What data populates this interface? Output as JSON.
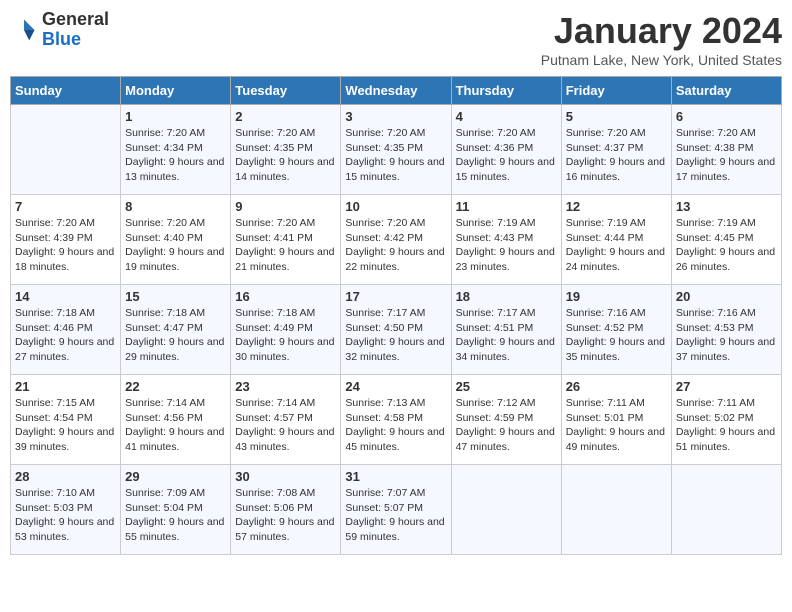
{
  "header": {
    "logo": {
      "general": "General",
      "blue": "Blue"
    },
    "title": "January 2024",
    "location": "Putnam Lake, New York, United States"
  },
  "weekdays": [
    "Sunday",
    "Monday",
    "Tuesday",
    "Wednesday",
    "Thursday",
    "Friday",
    "Saturday"
  ],
  "weeks": [
    [
      {
        "day": "",
        "sunrise": "",
        "sunset": "",
        "daylight": ""
      },
      {
        "day": "1",
        "sunrise": "Sunrise: 7:20 AM",
        "sunset": "Sunset: 4:34 PM",
        "daylight": "Daylight: 9 hours and 13 minutes."
      },
      {
        "day": "2",
        "sunrise": "Sunrise: 7:20 AM",
        "sunset": "Sunset: 4:35 PM",
        "daylight": "Daylight: 9 hours and 14 minutes."
      },
      {
        "day": "3",
        "sunrise": "Sunrise: 7:20 AM",
        "sunset": "Sunset: 4:35 PM",
        "daylight": "Daylight: 9 hours and 15 minutes."
      },
      {
        "day": "4",
        "sunrise": "Sunrise: 7:20 AM",
        "sunset": "Sunset: 4:36 PM",
        "daylight": "Daylight: 9 hours and 15 minutes."
      },
      {
        "day": "5",
        "sunrise": "Sunrise: 7:20 AM",
        "sunset": "Sunset: 4:37 PM",
        "daylight": "Daylight: 9 hours and 16 minutes."
      },
      {
        "day": "6",
        "sunrise": "Sunrise: 7:20 AM",
        "sunset": "Sunset: 4:38 PM",
        "daylight": "Daylight: 9 hours and 17 minutes."
      }
    ],
    [
      {
        "day": "7",
        "sunrise": "Sunrise: 7:20 AM",
        "sunset": "Sunset: 4:39 PM",
        "daylight": "Daylight: 9 hours and 18 minutes."
      },
      {
        "day": "8",
        "sunrise": "Sunrise: 7:20 AM",
        "sunset": "Sunset: 4:40 PM",
        "daylight": "Daylight: 9 hours and 19 minutes."
      },
      {
        "day": "9",
        "sunrise": "Sunrise: 7:20 AM",
        "sunset": "Sunset: 4:41 PM",
        "daylight": "Daylight: 9 hours and 21 minutes."
      },
      {
        "day": "10",
        "sunrise": "Sunrise: 7:20 AM",
        "sunset": "Sunset: 4:42 PM",
        "daylight": "Daylight: 9 hours and 22 minutes."
      },
      {
        "day": "11",
        "sunrise": "Sunrise: 7:19 AM",
        "sunset": "Sunset: 4:43 PM",
        "daylight": "Daylight: 9 hours and 23 minutes."
      },
      {
        "day": "12",
        "sunrise": "Sunrise: 7:19 AM",
        "sunset": "Sunset: 4:44 PM",
        "daylight": "Daylight: 9 hours and 24 minutes."
      },
      {
        "day": "13",
        "sunrise": "Sunrise: 7:19 AM",
        "sunset": "Sunset: 4:45 PM",
        "daylight": "Daylight: 9 hours and 26 minutes."
      }
    ],
    [
      {
        "day": "14",
        "sunrise": "Sunrise: 7:18 AM",
        "sunset": "Sunset: 4:46 PM",
        "daylight": "Daylight: 9 hours and 27 minutes."
      },
      {
        "day": "15",
        "sunrise": "Sunrise: 7:18 AM",
        "sunset": "Sunset: 4:47 PM",
        "daylight": "Daylight: 9 hours and 29 minutes."
      },
      {
        "day": "16",
        "sunrise": "Sunrise: 7:18 AM",
        "sunset": "Sunset: 4:49 PM",
        "daylight": "Daylight: 9 hours and 30 minutes."
      },
      {
        "day": "17",
        "sunrise": "Sunrise: 7:17 AM",
        "sunset": "Sunset: 4:50 PM",
        "daylight": "Daylight: 9 hours and 32 minutes."
      },
      {
        "day": "18",
        "sunrise": "Sunrise: 7:17 AM",
        "sunset": "Sunset: 4:51 PM",
        "daylight": "Daylight: 9 hours and 34 minutes."
      },
      {
        "day": "19",
        "sunrise": "Sunrise: 7:16 AM",
        "sunset": "Sunset: 4:52 PM",
        "daylight": "Daylight: 9 hours and 35 minutes."
      },
      {
        "day": "20",
        "sunrise": "Sunrise: 7:16 AM",
        "sunset": "Sunset: 4:53 PM",
        "daylight": "Daylight: 9 hours and 37 minutes."
      }
    ],
    [
      {
        "day": "21",
        "sunrise": "Sunrise: 7:15 AM",
        "sunset": "Sunset: 4:54 PM",
        "daylight": "Daylight: 9 hours and 39 minutes."
      },
      {
        "day": "22",
        "sunrise": "Sunrise: 7:14 AM",
        "sunset": "Sunset: 4:56 PM",
        "daylight": "Daylight: 9 hours and 41 minutes."
      },
      {
        "day": "23",
        "sunrise": "Sunrise: 7:14 AM",
        "sunset": "Sunset: 4:57 PM",
        "daylight": "Daylight: 9 hours and 43 minutes."
      },
      {
        "day": "24",
        "sunrise": "Sunrise: 7:13 AM",
        "sunset": "Sunset: 4:58 PM",
        "daylight": "Daylight: 9 hours and 45 minutes."
      },
      {
        "day": "25",
        "sunrise": "Sunrise: 7:12 AM",
        "sunset": "Sunset: 4:59 PM",
        "daylight": "Daylight: 9 hours and 47 minutes."
      },
      {
        "day": "26",
        "sunrise": "Sunrise: 7:11 AM",
        "sunset": "Sunset: 5:01 PM",
        "daylight": "Daylight: 9 hours and 49 minutes."
      },
      {
        "day": "27",
        "sunrise": "Sunrise: 7:11 AM",
        "sunset": "Sunset: 5:02 PM",
        "daylight": "Daylight: 9 hours and 51 minutes."
      }
    ],
    [
      {
        "day": "28",
        "sunrise": "Sunrise: 7:10 AM",
        "sunset": "Sunset: 5:03 PM",
        "daylight": "Daylight: 9 hours and 53 minutes."
      },
      {
        "day": "29",
        "sunrise": "Sunrise: 7:09 AM",
        "sunset": "Sunset: 5:04 PM",
        "daylight": "Daylight: 9 hours and 55 minutes."
      },
      {
        "day": "30",
        "sunrise": "Sunrise: 7:08 AM",
        "sunset": "Sunset: 5:06 PM",
        "daylight": "Daylight: 9 hours and 57 minutes."
      },
      {
        "day": "31",
        "sunrise": "Sunrise: 7:07 AM",
        "sunset": "Sunset: 5:07 PM",
        "daylight": "Daylight: 9 hours and 59 minutes."
      },
      {
        "day": "",
        "sunrise": "",
        "sunset": "",
        "daylight": ""
      },
      {
        "day": "",
        "sunrise": "",
        "sunset": "",
        "daylight": ""
      },
      {
        "day": "",
        "sunrise": "",
        "sunset": "",
        "daylight": ""
      }
    ]
  ]
}
